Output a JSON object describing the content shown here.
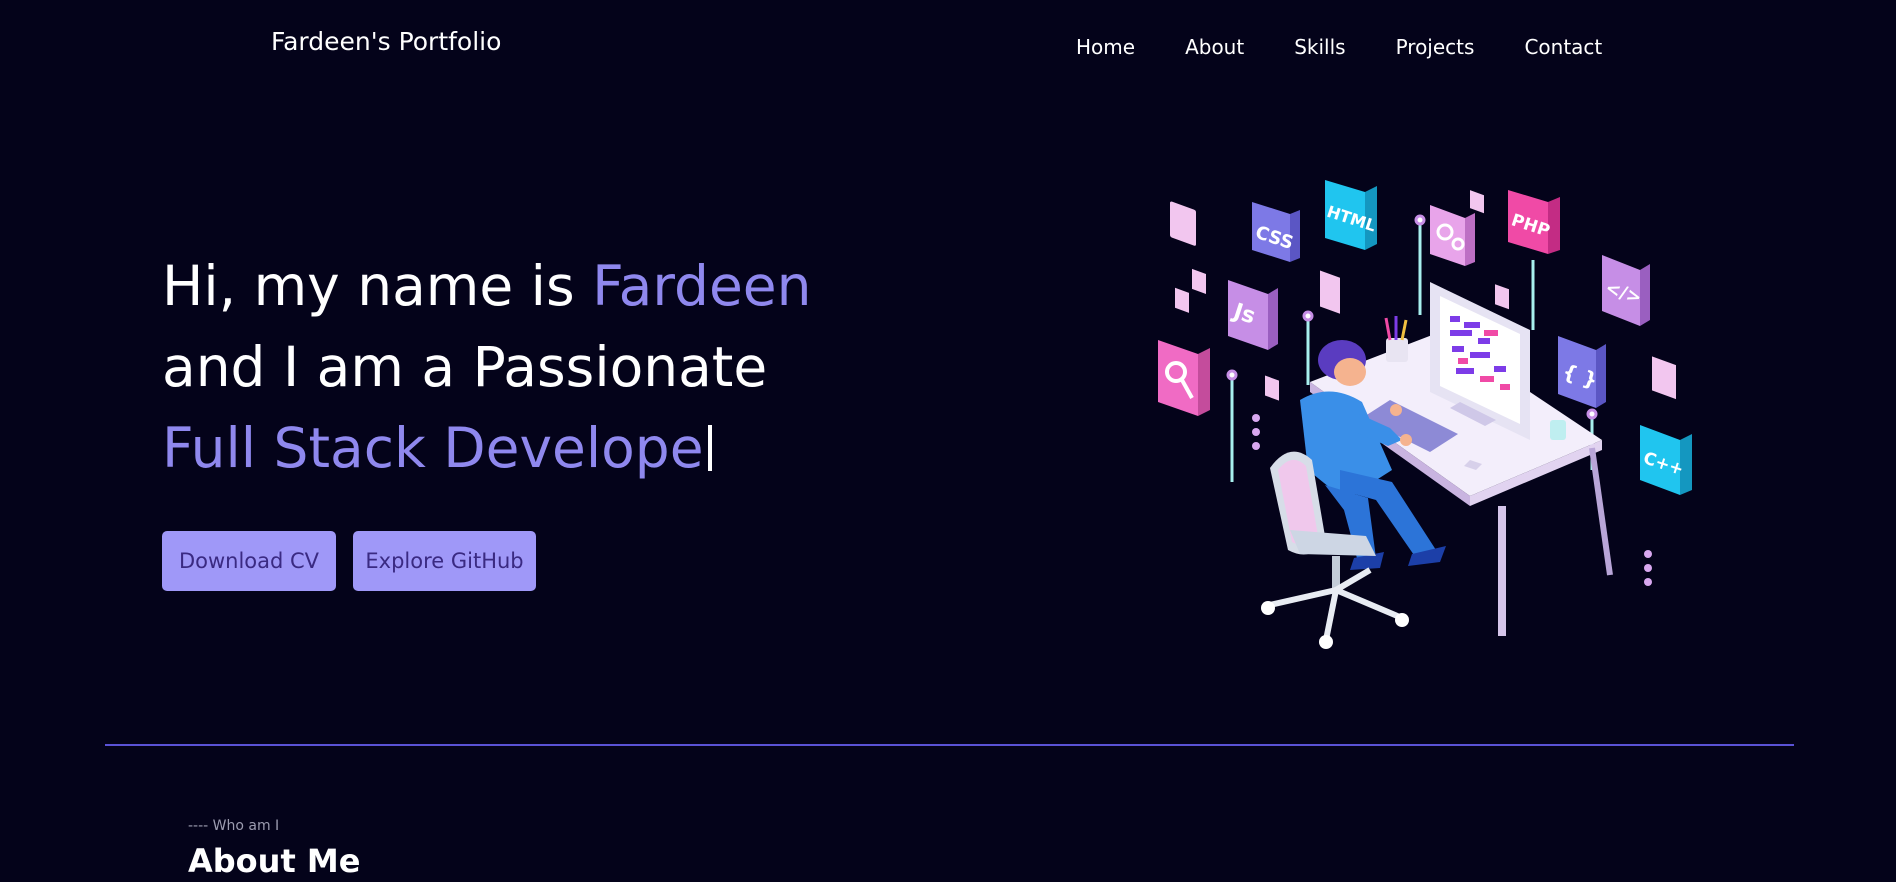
{
  "nav": {
    "brand": "Fardeen's Portfolio",
    "links": [
      "Home",
      "About",
      "Skills",
      "Projects",
      "Contact"
    ]
  },
  "hero": {
    "line1_prefix": "Hi, my name is ",
    "line1_name": "Fardeen",
    "line2": "and I am a Passionate",
    "line3_typed": "Full Stack Develope",
    "buttons": {
      "download_cv": "Download CV",
      "explore_github": "Explore GitHub"
    },
    "illustration_tiles": [
      "CSS",
      "HTML",
      "PHP",
      "Js",
      "</>",
      "{ }",
      "C++"
    ]
  },
  "about": {
    "eyebrow": "---- Who am I",
    "title": "About Me"
  },
  "colors": {
    "background": "#04031a",
    "accent": "#8f88ee",
    "button_bg": "#9f98f8",
    "button_text": "#3a2a82",
    "divider": "#5a52d6"
  }
}
